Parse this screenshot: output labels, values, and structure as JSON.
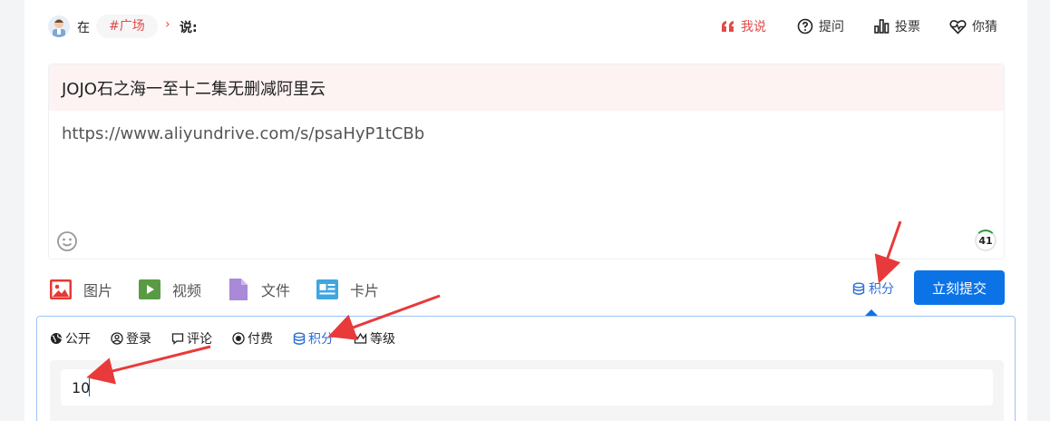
{
  "header": {
    "prefix": "在",
    "topic": "#广场",
    "chevron": "›",
    "suffix": "说:"
  },
  "modes": [
    {
      "label": "我说",
      "icon": "quote-icon",
      "active": true
    },
    {
      "label": "提问",
      "icon": "question-circle-icon",
      "active": false
    },
    {
      "label": "投票",
      "icon": "bar-chart-icon",
      "active": false
    },
    {
      "label": "你猜",
      "icon": "heart-pulse-icon",
      "active": false
    }
  ],
  "editor": {
    "title": "JOJO石之海一至十二集无删减阿里云",
    "body": "https://www.aliyundrive.com/s/psaHyP1tCBb",
    "counter": "41"
  },
  "media_tools": [
    {
      "label": "图片",
      "icon": "image-icon",
      "color": "#e53935"
    },
    {
      "label": "视频",
      "icon": "video-icon",
      "color": "#4caf50"
    },
    {
      "label": "文件",
      "icon": "file-icon",
      "color": "#9c7bd6"
    },
    {
      "label": "卡片",
      "icon": "card-icon",
      "color": "#3fa6e0"
    }
  ],
  "actions": {
    "points_label": "积分",
    "submit_label": "立刻提交"
  },
  "permissions": [
    {
      "label": "公开",
      "icon": "globe-icon",
      "active": false
    },
    {
      "label": "登录",
      "icon": "user-circle-icon",
      "active": false
    },
    {
      "label": "评论",
      "icon": "comment-icon",
      "active": false
    },
    {
      "label": "付费",
      "icon": "coin-icon",
      "active": false
    },
    {
      "label": "积分",
      "icon": "database-icon",
      "active": true
    },
    {
      "label": "等级",
      "icon": "crown-icon",
      "active": false
    }
  ],
  "points_input": {
    "value": "10"
  },
  "colors": {
    "accent_red": "#e04b4b",
    "accent_blue": "#0b73e6",
    "title_bg": "#fdf3f2",
    "annotation_arrow": "#e83a3a"
  }
}
